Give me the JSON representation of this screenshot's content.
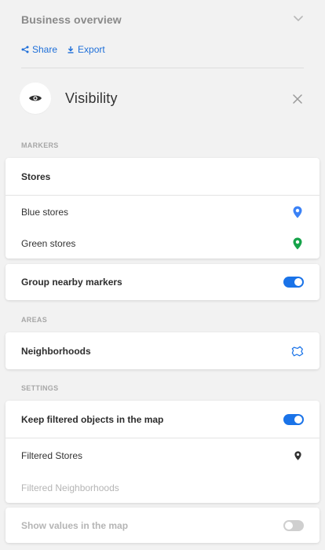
{
  "header": {
    "title": "Business overview",
    "share_label": "Share",
    "export_label": "Export"
  },
  "visibility": {
    "title": "Visibility"
  },
  "sections": {
    "markers_label": "MARKERS",
    "areas_label": "AREAS",
    "settings_label": "SETTINGS"
  },
  "markers": {
    "stores_label": "Stores",
    "blue_stores_label": "Blue stores",
    "green_stores_label": "Green stores",
    "group_nearby_label": "Group nearby markers",
    "group_nearby_on": true,
    "blue_color": "#3b82f6",
    "green_color": "#16a34a"
  },
  "areas": {
    "neighborhoods_label": "Neighborhoods"
  },
  "settings": {
    "keep_filtered_label": "Keep filtered objects in the map",
    "keep_filtered_on": true,
    "filtered_stores_label": "Filtered Stores",
    "filtered_neighborhoods_label": "Filtered Neighborhoods",
    "show_values_label": "Show values in the map",
    "show_values_on": false
  },
  "colors": {
    "accent": "#1a73e8",
    "link": "#1e6fd9"
  },
  "icons": {
    "chevron": "chevron-down-icon",
    "share": "share-icon",
    "export": "download-icon",
    "eye": "eye-icon",
    "close": "close-icon",
    "blue_pin": "map-pin-icon",
    "green_pin": "map-pin-icon",
    "area": "polygon-area-icon",
    "filtered_pin": "map-pin-icon"
  }
}
